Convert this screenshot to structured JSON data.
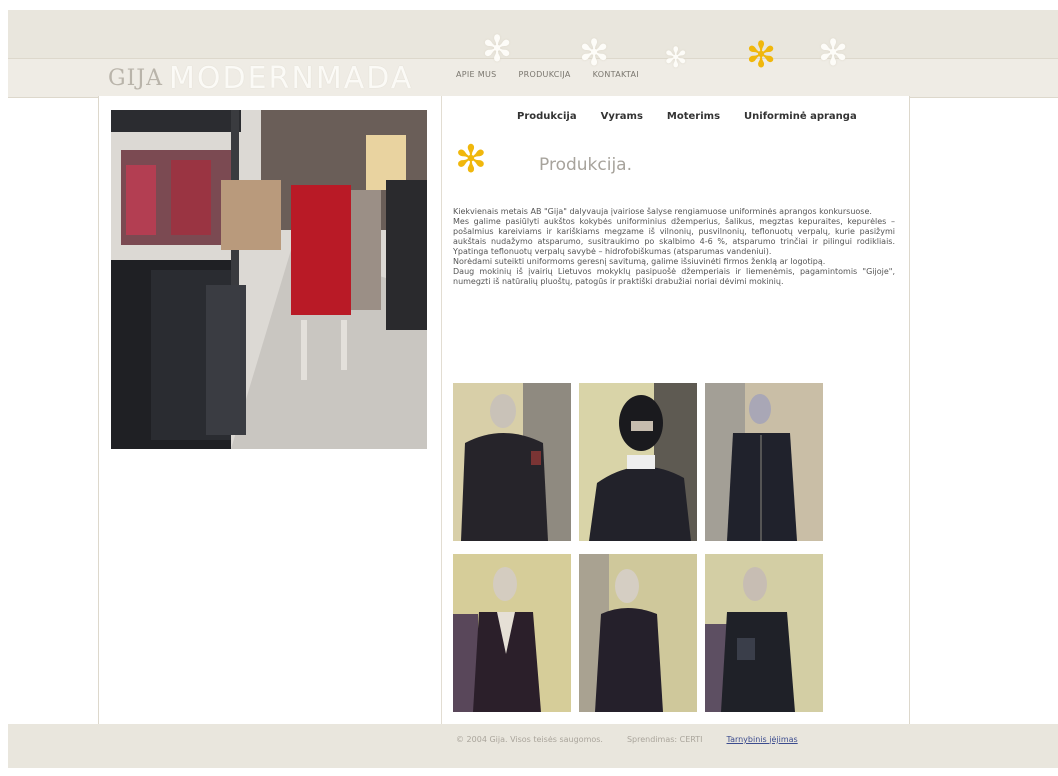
{
  "header": {
    "logo_mark": "GIJA",
    "logo_word": "MODERNMADA"
  },
  "nav": {
    "items": [
      {
        "label": "APIE MUS"
      },
      {
        "label": "PRODUKCIJA"
      },
      {
        "label": "KONTAKTAI"
      }
    ]
  },
  "subnav": {
    "items": [
      {
        "label": "Produkcija"
      },
      {
        "label": "Vyrams"
      },
      {
        "label": "Moterims"
      },
      {
        "label": "Uniforminė apranga"
      }
    ]
  },
  "main": {
    "title": "Produkcija.",
    "paragraphs": [
      "Kiekvienais metais AB \"Gija\" dalyvauja įvairiose šalyse rengiamuose uniforminės aprangos konkursuose.",
      "Mes galime pasiūlyti aukštos kokybės uniforminius džemperius, šalikus, megztas kepuraites, kepurėles – pošalmius kareiviams ir kariškiams megzame iš vilnonių, pusvilnonių, teflonuotų verpalų, kurie pasižymi aukštais nudažymo atsparumo, susitraukimo po skalbimo 4-6 %, atsparumo trinčiai ir pilingui rodikliais. Ypatinga teflonuotų verpalų savybė – hidrofobiškumas (atsparumas vandeniui).",
      "Norėdami suteikti uniformoms geresnį savitumą, galime išsiuvinėti firmos ženklą ar logotipą.",
      "Daug mokinių iš įvairių Lietuvos mokyklų pasipuošė džemperiais ir liemenėmis, pagamintomis \"Gijoje\", numegzti iš natūralių pluoštų, patogūs ir praktiški drabužiai noriai dėvimi mokinių."
    ]
  },
  "gallery": {
    "items": [
      {
        "name": "crew-neck-sweater-with-patch"
      },
      {
        "name": "balaclava-and-sweater"
      },
      {
        "name": "zip-cardigan-uniform"
      },
      {
        "name": "v-neck-cardigan"
      },
      {
        "name": "crew-neck-sweater"
      },
      {
        "name": "vest-with-pocket"
      }
    ]
  },
  "footer": {
    "copyright": "© 2004 Gija. Visos teisės saugomos.",
    "credit": "Sprendimas: CERTI",
    "link": "Tarnybinis įėjimas"
  },
  "colors": {
    "band": "#e9e6dd",
    "accent_yellow": "#f0b70c",
    "title_gray": "#a7a39c",
    "link_blue": "#3c4c8e"
  }
}
